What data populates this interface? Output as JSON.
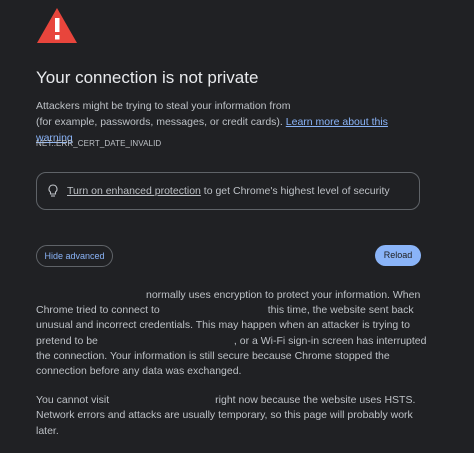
{
  "page": {
    "title": "Your connection is not private",
    "intro_part1": "Attackers might be trying to steal your information from",
    "intro_part2": "(for example, passwords, messages, or credit cards).",
    "learn_more_link": "Learn more about this warning",
    "error_code": "NET::ERR_CERT_DATE_INVALID"
  },
  "enhanced_protection": {
    "icon": "lightbulb-icon",
    "link": "Turn on enhanced protection",
    "text": "to get Chrome's highest level of security"
  },
  "buttons": {
    "hide_advanced": "Hide advanced",
    "reload": "Reload"
  },
  "details": {
    "p1_a": "normally uses encryption to protect your information. When Chrome tried to connect to",
    "p1_b": "this time, the website sent back unusual and incorrect credentials. This may happen when an attacker is trying to pretend to be",
    "p1_c": ", or a Wi-Fi sign-in screen has interrupted the connection. Your information is still secure because Chrome stopped the connection before any data was exchanged.",
    "p2_a": "You cannot visit",
    "p2_b": "right now because the website uses HSTS. Network errors and attacks are usually temporary, so this page will probably work later."
  },
  "colors": {
    "background": "#202124",
    "warning_red": "#e8453c",
    "link_blue": "#8ab4f8",
    "title_text": "#e8eaed",
    "body_text": "#bdc1c6"
  }
}
